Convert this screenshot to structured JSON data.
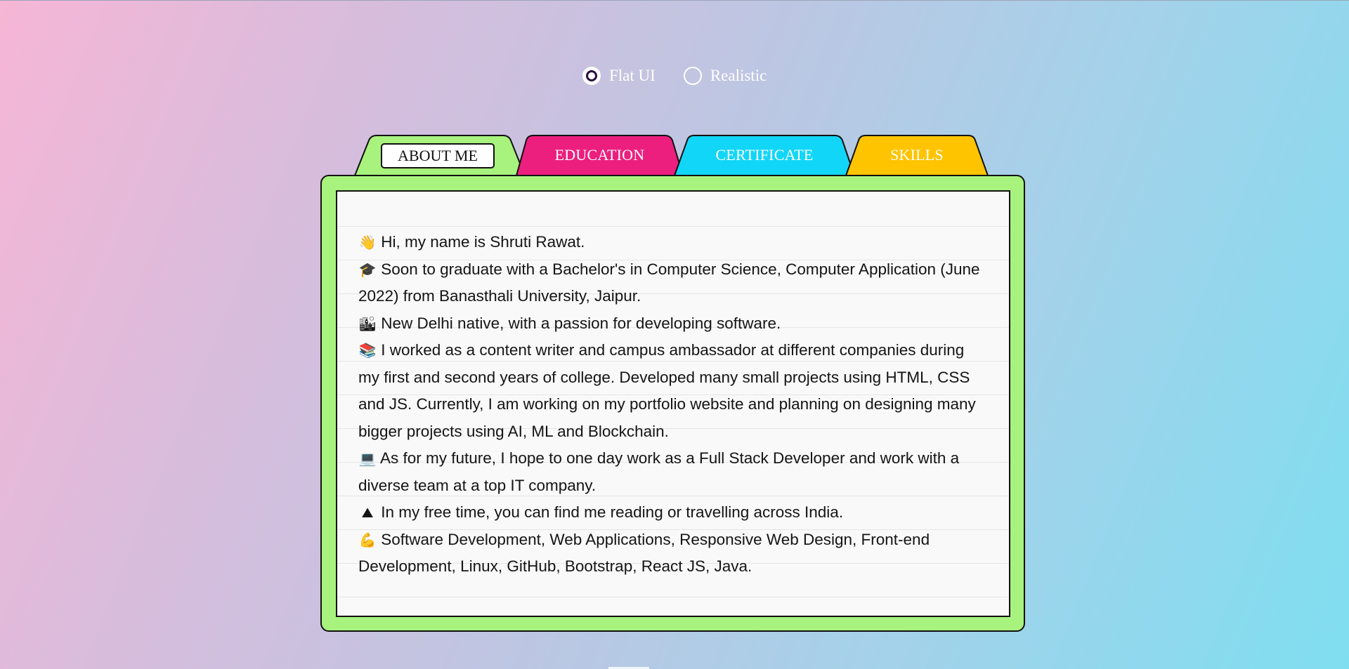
{
  "mode_selector": {
    "options": [
      {
        "label": "Flat UI",
        "selected": true
      },
      {
        "label": "Realistic",
        "selected": false
      }
    ]
  },
  "tabs": [
    {
      "label": "ABOUT ME",
      "color": "#a8f27e",
      "active": true
    },
    {
      "label": "EDUCATION",
      "color": "#ec1f7f",
      "active": false
    },
    {
      "label": "CERTIFICATE",
      "color": "#12d6f7",
      "active": false
    },
    {
      "label": "SKILLS",
      "color": "#ffc400",
      "active": false
    }
  ],
  "about": {
    "paragraphs": [
      {
        "icon": "waving-hand-icon",
        "glyph": "👋",
        "text": "Hi, my name is Shruti Rawat."
      },
      {
        "icon": "graduation-cap-icon",
        "glyph": "🎓",
        "text": "Soon to graduate with a Bachelor's in Computer Science, Computer Application (June 2022) from Banasthali University, Jaipur."
      },
      {
        "icon": "city-icon",
        "glyph": "🏙",
        "text": "New Delhi native, with a passion for developing software."
      },
      {
        "icon": "books-icon",
        "glyph": "📚",
        "text": "I worked as a content writer and campus ambassador at different companies during my first and second years of college. Developed many small projects using HTML, CSS and JS. Currently, I am working on my portfolio website and planning on designing many bigger projects using AI, ML and Blockchain."
      },
      {
        "icon": "laptop-icon",
        "glyph": "💻",
        "text": "As for my future, I hope to one day work as a Full Stack Developer and work with a diverse team at a top IT company."
      },
      {
        "icon": "mountain-icon",
        "glyph": "⛰",
        "text": "In my free time, you can find me reading or travelling across India."
      },
      {
        "icon": "flexed-biceps-icon",
        "glyph": "💪",
        "text": "Software Development, Web Applications, Responsive Web Design, Front-end Development, Linux, GitHub, Bootstrap, React JS, Java."
      }
    ]
  }
}
